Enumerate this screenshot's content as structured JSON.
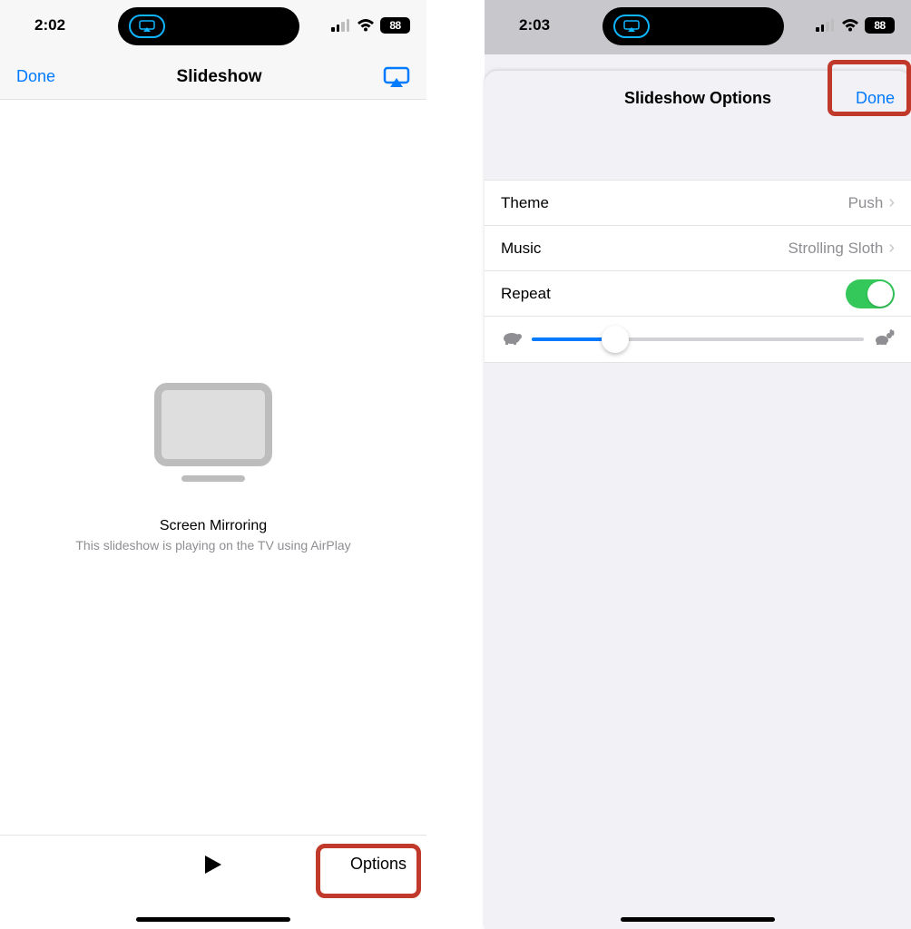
{
  "left": {
    "status": {
      "time": "2:02",
      "battery": "88"
    },
    "nav": {
      "done": "Done",
      "title": "Slideshow"
    },
    "content": {
      "mirroring_title": "Screen Mirroring",
      "mirroring_subtitle": "This slideshow is playing on the TV using AirPlay"
    },
    "bottom": {
      "options": "Options"
    }
  },
  "right": {
    "status": {
      "time": "2:03",
      "battery": "88"
    },
    "sheet": {
      "title": "Slideshow Options",
      "done": "Done",
      "rows": {
        "theme_label": "Theme",
        "theme_value": "Push",
        "music_label": "Music",
        "music_value": "Strolling Sloth",
        "repeat_label": "Repeat"
      },
      "speed_percent": 25
    }
  }
}
